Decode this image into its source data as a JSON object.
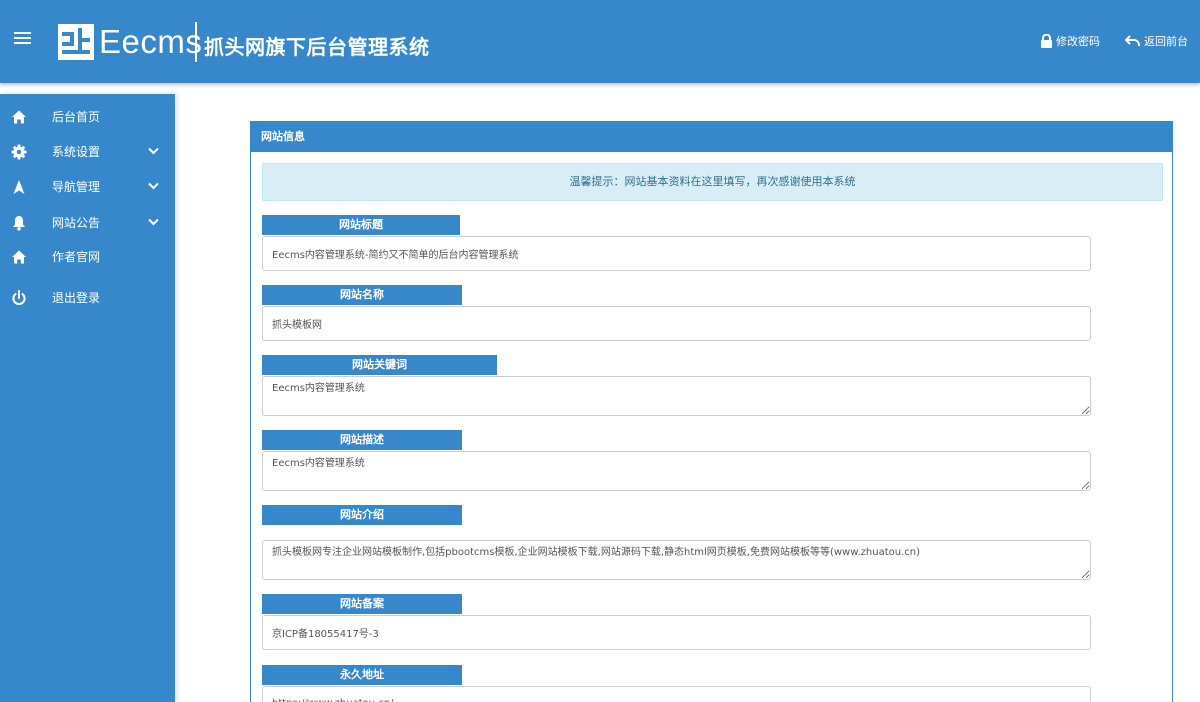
{
  "header": {
    "logo_text": "Eecms",
    "site_title": "抓头网旗下后台管理系统",
    "change_password": "修改密码",
    "back_to_front": "返回前台"
  },
  "sidebar": {
    "items": [
      {
        "label": "后台首页",
        "icon": "home-icon",
        "has_submenu": false
      },
      {
        "label": "系统设置",
        "icon": "gear-icon",
        "has_submenu": true
      },
      {
        "label": "导航管理",
        "icon": "navigation-icon",
        "has_submenu": true
      },
      {
        "label": "网站公告",
        "icon": "bell-icon",
        "has_submenu": true
      },
      {
        "label": "作者官网",
        "icon": "home-icon",
        "has_submenu": false
      },
      {
        "label": "退出登录",
        "icon": "power-icon",
        "has_submenu": false
      }
    ]
  },
  "panel": {
    "title": "网站信息",
    "tip": "温馨提示：网站基本资料在这里填写，再次感谢使用本系统",
    "fields": [
      {
        "label": "网站标题",
        "value": "Eecms内容管理系统-简约又不简单的后台内容管理系统",
        "type": "input"
      },
      {
        "label": "网站名称",
        "value": "抓头模板网",
        "type": "input"
      },
      {
        "label": "网站关键词",
        "value": "Eecms内容管理系统",
        "type": "textarea"
      },
      {
        "label": "网站描述",
        "value": "Eecms内容管理系统",
        "type": "textarea"
      },
      {
        "label": "网站介绍",
        "value": "抓头模板网专注企业网站模板制作,包括pbootcms模板,企业网站模板下载,网站源码下载,静态html网页模板,免费网站模板等等(www.zhuatou.cn)",
        "type": "textarea"
      },
      {
        "label": "网站备案",
        "value": "京ICP备18055417号-3",
        "type": "input"
      },
      {
        "label": "永久地址",
        "value": "https://www.zhuatou.cn/",
        "type": "input"
      }
    ]
  }
}
